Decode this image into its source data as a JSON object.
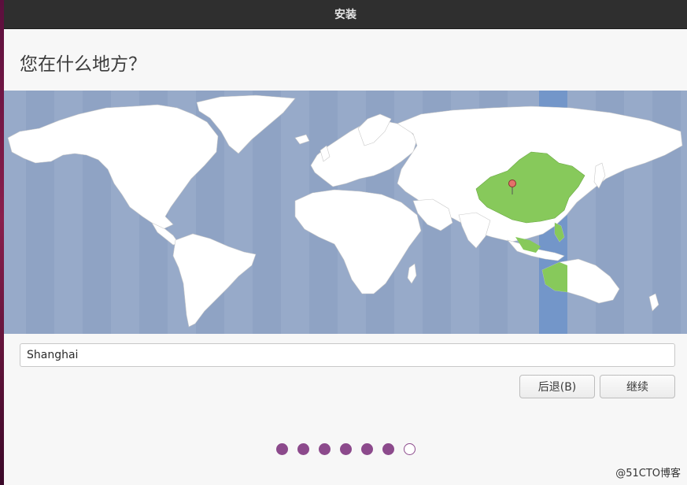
{
  "window": {
    "title": "安装"
  },
  "page": {
    "heading": "您在什么地方？"
  },
  "map": {
    "selected_region": "Asia/Shanghai",
    "colors": {
      "ocean": "#97aac9",
      "land": "#ffffff",
      "selected_zone": "#7396c9",
      "selected_country": "#87c95b",
      "pin": "#e4716a"
    }
  },
  "timezone": {
    "value": "Shanghai"
  },
  "buttons": {
    "back": "后退(B)",
    "continue": "继续"
  },
  "progress": {
    "total_steps": 7,
    "current_step": 7
  },
  "watermark": "@51CTO博客"
}
